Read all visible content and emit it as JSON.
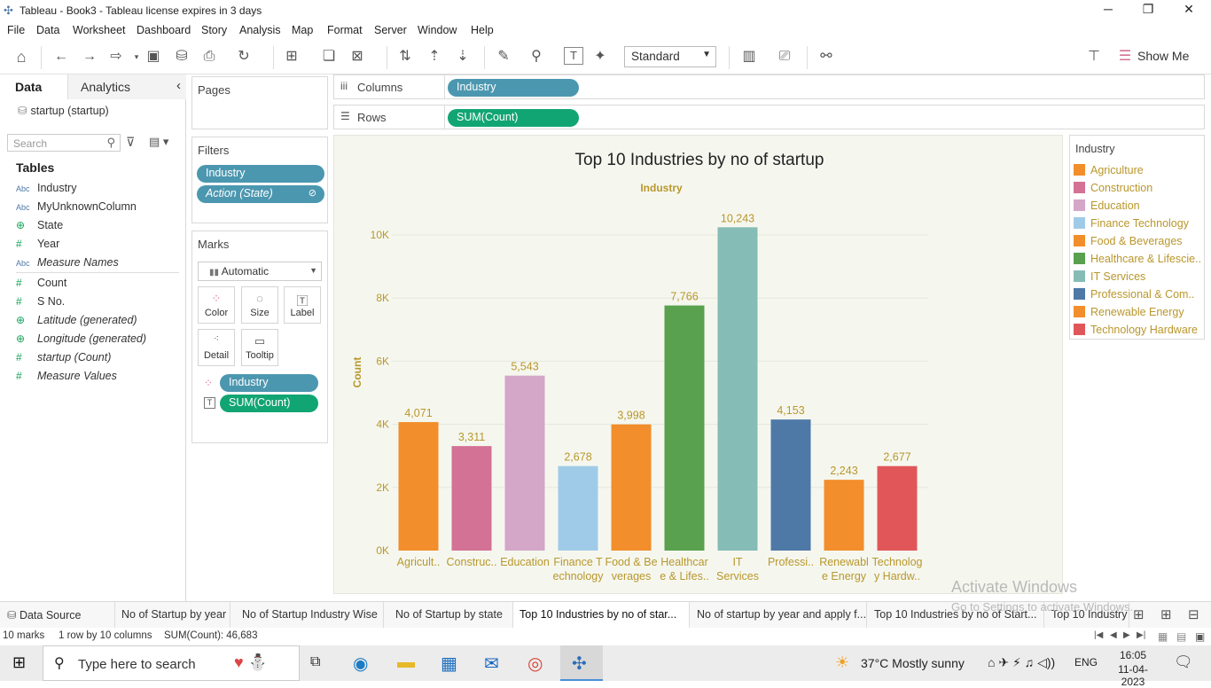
{
  "window": {
    "title": "Tableau - Book3 - Tableau license expires in 3 days"
  },
  "menu": [
    "File",
    "Data",
    "Worksheet",
    "Dashboard",
    "Story",
    "Analysis",
    "Map",
    "Format",
    "Server",
    "Window",
    "Help"
  ],
  "toolbar": {
    "standard_label": "Standard",
    "show_me_label": "Show Me"
  },
  "left": {
    "data_tab": "Data",
    "analytics_tab": "Analytics",
    "data_source": "startup (startup)",
    "search_placeholder": "Search",
    "tables_heading": "Tables",
    "fields": [
      {
        "type": "Abc",
        "name": "Industry",
        "italic": false
      },
      {
        "type": "Abc",
        "name": "MyUnknownColumn",
        "italic": false
      },
      {
        "type": "globe",
        "name": "State",
        "italic": false
      },
      {
        "type": "#",
        "name": "Year",
        "italic": false
      },
      {
        "type": "Abc",
        "name": "Measure Names",
        "italic": true
      },
      {
        "type": "#",
        "name": "Count",
        "italic": false
      },
      {
        "type": "#",
        "name": "S No.",
        "italic": false
      },
      {
        "type": "globe",
        "name": "Latitude (generated)",
        "italic": true
      },
      {
        "type": "globe",
        "name": "Longitude (generated)",
        "italic": true
      },
      {
        "type": "#",
        "name": "startup (Count)",
        "italic": true
      },
      {
        "type": "#",
        "name": "Measure Values",
        "italic": true
      }
    ]
  },
  "pages": {
    "label": "Pages"
  },
  "filters": {
    "label": "Filters",
    "items": [
      "Industry",
      "Action (State)"
    ]
  },
  "marks": {
    "label": "Marks",
    "type": "Automatic",
    "buttons": [
      "Color",
      "Size",
      "Label",
      "Detail",
      "Tooltip"
    ],
    "pills": [
      "Industry",
      "SUM(Count)"
    ]
  },
  "shelves": {
    "columns_label": "Columns",
    "columns_pill": "Industry",
    "rows_label": "Rows",
    "rows_pill": "SUM(Count)"
  },
  "chart_data": {
    "type": "bar",
    "title": "Top 10 Industries by no of startup",
    "xlabel": "Industry",
    "ylabel": "Count",
    "ylim": [
      0,
      10000
    ],
    "yticks": [
      "0K",
      "2K",
      "4K",
      "6K",
      "8K",
      "10K"
    ],
    "categories": [
      "Agriculture",
      "Construction",
      "Education",
      "Finance Technology",
      "Food & Beverages",
      "Healthcare & Lifesciences",
      "IT Services",
      "Professional & Commercial Services",
      "Renewable Energy",
      "Technology Hardware"
    ],
    "tick_labels": [
      [
        "Agricult.."
      ],
      [
        "Construc.."
      ],
      [
        "Education"
      ],
      [
        "Finance T",
        "echnology"
      ],
      [
        "Food & Be",
        "verages"
      ],
      [
        "Healthcar",
        "e & Lifes.."
      ],
      [
        "IT",
        "Services"
      ],
      [
        "Professi.."
      ],
      [
        "Renewabl",
        "e Energy"
      ],
      [
        "Technolog",
        "y Hardw.."
      ]
    ],
    "values": [
      4071,
      3311,
      5543,
      2678,
      3998,
      7766,
      10243,
      4153,
      2243,
      2677
    ],
    "value_labels": [
      "4,071",
      "3,311",
      "5,543",
      "2,678",
      "3,998",
      "7,766",
      "10,243",
      "4,153",
      "2,243",
      "2,677"
    ],
    "colors": [
      "#f28e2b",
      "#d37295",
      "#d4a6c8",
      "#a0cbe8",
      "#f28e2b",
      "#59a14f",
      "#86bcb6",
      "#4e79a7",
      "#f28e2b",
      "#e15759"
    ],
    "grid": true
  },
  "legend": {
    "title": "Industry",
    "items": [
      {
        "label": "Agriculture",
        "color": "#f28e2b"
      },
      {
        "label": "Construction",
        "color": "#d37295"
      },
      {
        "label": "Education",
        "color": "#d4a6c8"
      },
      {
        "label": "Finance Technology",
        "color": "#a0cbe8"
      },
      {
        "label": "Food & Beverages",
        "color": "#f28e2b"
      },
      {
        "label": "Healthcare & Lifescie..",
        "color": "#59a14f"
      },
      {
        "label": "IT Services",
        "color": "#86bcb6"
      },
      {
        "label": "Professional & Com..",
        "color": "#4e79a7"
      },
      {
        "label": "Renewable Energy",
        "color": "#f28e2b"
      },
      {
        "label": "Technology Hardware",
        "color": "#e15759"
      }
    ]
  },
  "watermark": {
    "line1": "Activate Windows",
    "line2": "Go to Settings to activate Windows."
  },
  "sheet_tabs": {
    "data_source": "Data Source",
    "tabs": [
      "No of Startup by year",
      "No of Startup Industry Wise",
      "No of Startup by state",
      "Top 10 Industries by no of star...",
      "No of startup by year and apply f...",
      "Top 10 Industries by no of Start...",
      "Top 10 Industry"
    ],
    "active_index": 3
  },
  "status": {
    "marks": "10 marks",
    "dims": "1 row by 10 columns",
    "sum": "SUM(Count): 46,683"
  },
  "taskbar": {
    "search_placeholder": "Type here to search",
    "weather": "37°C  Mostly sunny",
    "lang": "ENG",
    "time": "16:05",
    "date": "11-04-2023"
  },
  "colors": {
    "accent_blue": "#4c97b0",
    "accent_green": "#12a574",
    "chart_bg": "#f5f7ef",
    "label_gold": "#b9972c"
  }
}
